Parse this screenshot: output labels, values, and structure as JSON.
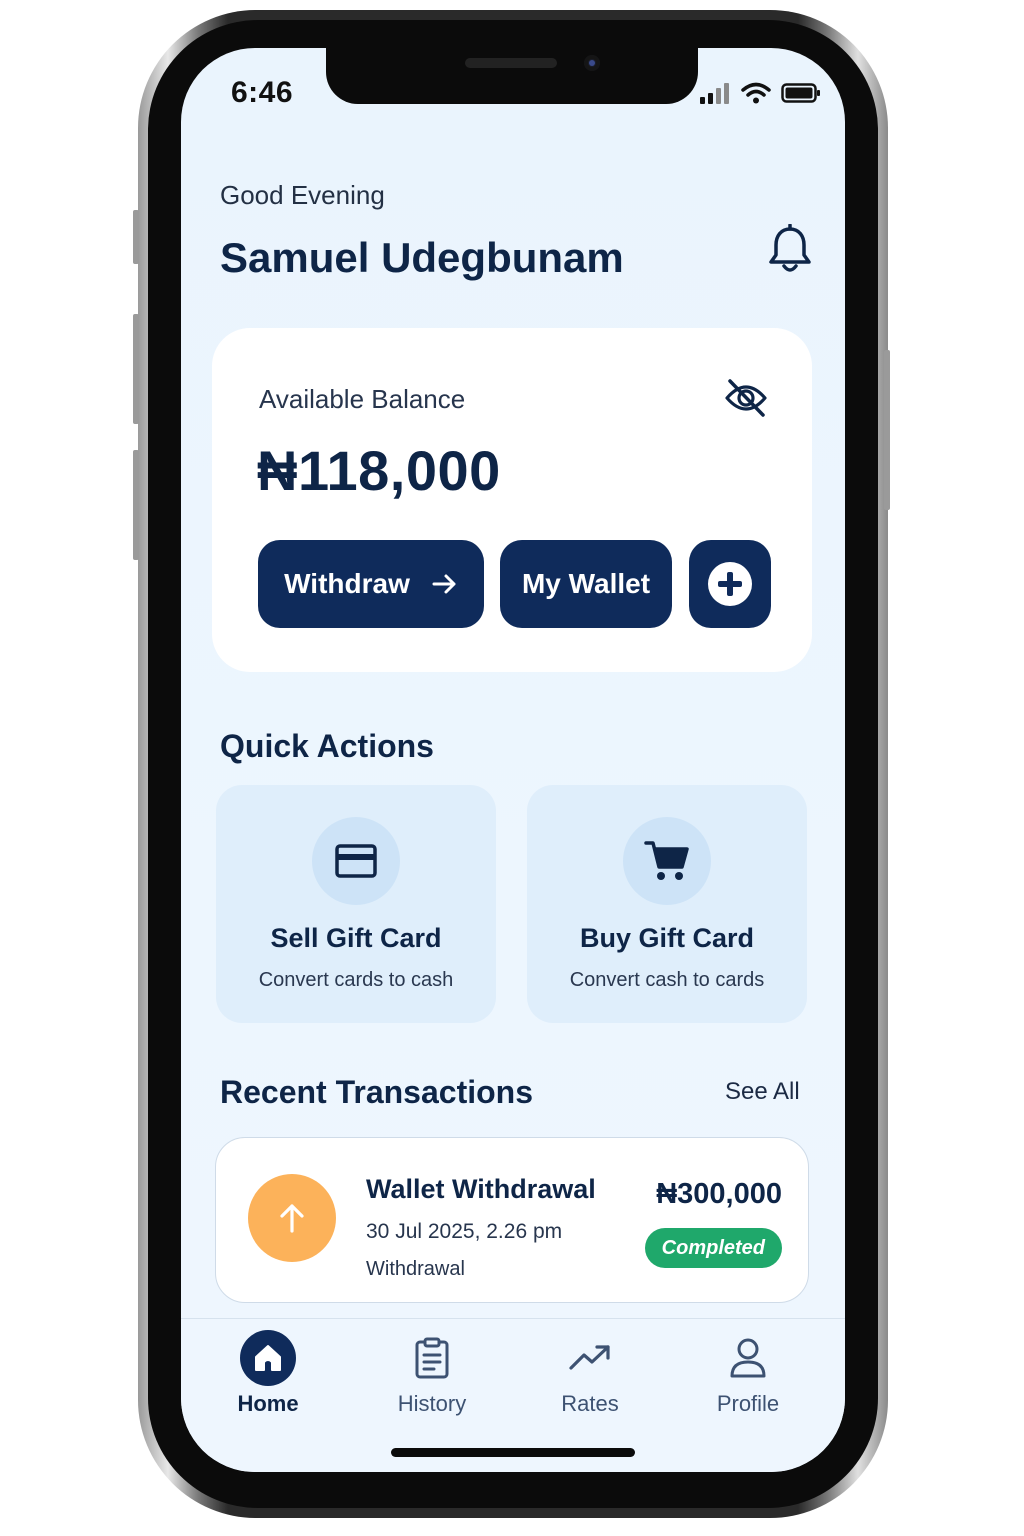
{
  "status_bar": {
    "time": "6:46"
  },
  "header": {
    "greeting": "Good Evening",
    "user_name": "Samuel Udegbunam",
    "icon": "bell-icon"
  },
  "balance_card": {
    "label": "Available Balance",
    "amount": "₦118,000",
    "visibility_icon": "eye-off-icon",
    "actions": {
      "withdraw_label": "Withdraw",
      "wallet_label": "My Wallet",
      "add_icon": "plus-circle-icon"
    }
  },
  "quick_actions": {
    "title": "Quick Actions",
    "items": [
      {
        "title": "Sell Gift Card",
        "subtitle": "Convert cards to cash",
        "icon": "credit-card-icon"
      },
      {
        "title": "Buy Gift Card",
        "subtitle": "Convert cash to cards",
        "icon": "shopping-cart-icon"
      }
    ]
  },
  "recent_transactions": {
    "title": "Recent Transactions",
    "see_all": "See All",
    "items": [
      {
        "title": "Wallet Withdrawal",
        "date": "30 Jul 2025, 2.26 pm",
        "type": "Withdrawal",
        "amount": "₦300,000",
        "status": "Completed",
        "icon": "arrow-up-icon"
      }
    ]
  },
  "tab_bar": {
    "active": "Home",
    "tabs": [
      {
        "label": "Home",
        "icon": "home-icon"
      },
      {
        "label": "History",
        "icon": "clipboard-icon"
      },
      {
        "label": "Rates",
        "icon": "trending-up-icon"
      },
      {
        "label": "Profile",
        "icon": "user-icon"
      }
    ]
  },
  "colors": {
    "primary": "#0f2b5b",
    "background": "#eaf4fd",
    "success": "#1fa86b",
    "withdrawal_icon_bg": "#fcb25a"
  }
}
